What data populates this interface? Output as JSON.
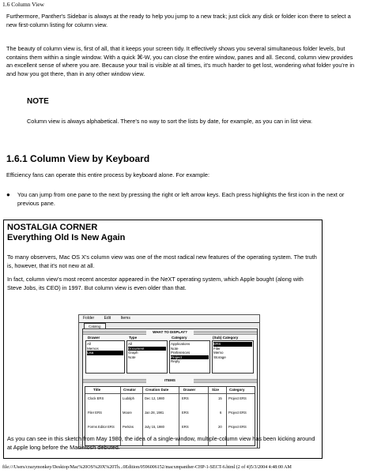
{
  "header": "1.6 Column View",
  "paragraphs": {
    "p1": "Furthermore, Panther's Sidebar is always at the ready to help you jump to a new track; just click any disk or folder icon there to select a new first-column listing for column view.",
    "p2": "The beauty of column view is, first of all, that it keeps your screen tidy. It effectively shows you several simultaneous folder levels, but contains them within a single window. With a quick ⌘-W, you can close the entire window, panes and all. Second, column view provides an excellent sense of where you are. Because your trail is visible at all times, it's much harder to get lost, wondering what folder you're in and how you got there, than in any other window view."
  },
  "note": {
    "heading": "NOTE",
    "body": "Column view is always alphabetical. There's no way to sort the lists by date, for example, as you can in list view."
  },
  "section": {
    "title": "1.6.1 Column View by Keyboard",
    "intro": "Efficiency fans can operate this entire process by keyboard alone. For example:",
    "bullet": "You can jump from one pane to the next by pressing the right or left arrow keys. Each press highlights the first icon in the next or previous pane."
  },
  "sidebar_box": {
    "title1": "NOSTALGIA CORNER",
    "title2": "Everything Old Is New Again",
    "p1": "To many observers, Mac OS X's column view was one of the most radical new features of the operating system. The truth is, however, that it's not new at all.",
    "p2": "In fact, column view's most recent ancestor appeared in the NeXT operating system, which Apple bought (along with Steve Jobs, its CEO) in 1997. But column view is even older than that.",
    "p3": "As you can see in this sketch from May 1980, the idea of a single-window, multiple-column view has been kicking around at Apple long before the Macintosh debuted."
  },
  "sketch": {
    "menu": [
      "Folder",
      "Edit",
      "Items"
    ],
    "tab": "Catalog",
    "top_bar": "WHAT TO DISPLAY?",
    "columns": [
      {
        "head": "Drawer",
        "items": [
          "All",
          "Memos",
          "Lisa"
        ],
        "selected": 2
      },
      {
        "head": "Type",
        "items": [
          "All",
          "Document",
          "Graph",
          "Note"
        ],
        "selected": 1
      },
      {
        "head": "Category",
        "items": [
          "Applications",
          "Note",
          "Preferences",
          "Project",
          "Reply"
        ],
        "selected": 3
      },
      {
        "head": "(Sub) Category",
        "items": [
          "ERS",
          "Filer",
          "Memo",
          "Storage"
        ],
        "selected": 0
      }
    ],
    "items_bar": "ITEMS",
    "table_headers": [
      "Title",
      "Creator",
      "Creation Date",
      "Drawer",
      "Size",
      "Category"
    ],
    "rows": [
      [
        "Clock ERS",
        "Ludolph",
        "Dec 12, 1980",
        "ERS",
        "15",
        "Project ERS"
      ],
      [
        "Filer ERS",
        "Moore",
        "Jan 28, 1981",
        "ERS",
        "6",
        "Project ERS"
      ],
      [
        "Forms Editor ERS",
        "Perkins",
        "July 15, 1980",
        "ERS",
        "20",
        "Project ERS"
      ]
    ]
  },
  "footer": "file:///Users/crazymonkey/Desktop/Mac%20OS%20X%20Th...0Edition/059600615​2/macxmpanther-CHP-1-SECT-6.html (2 of 4)5/3/2004 4:48:00 AM"
}
